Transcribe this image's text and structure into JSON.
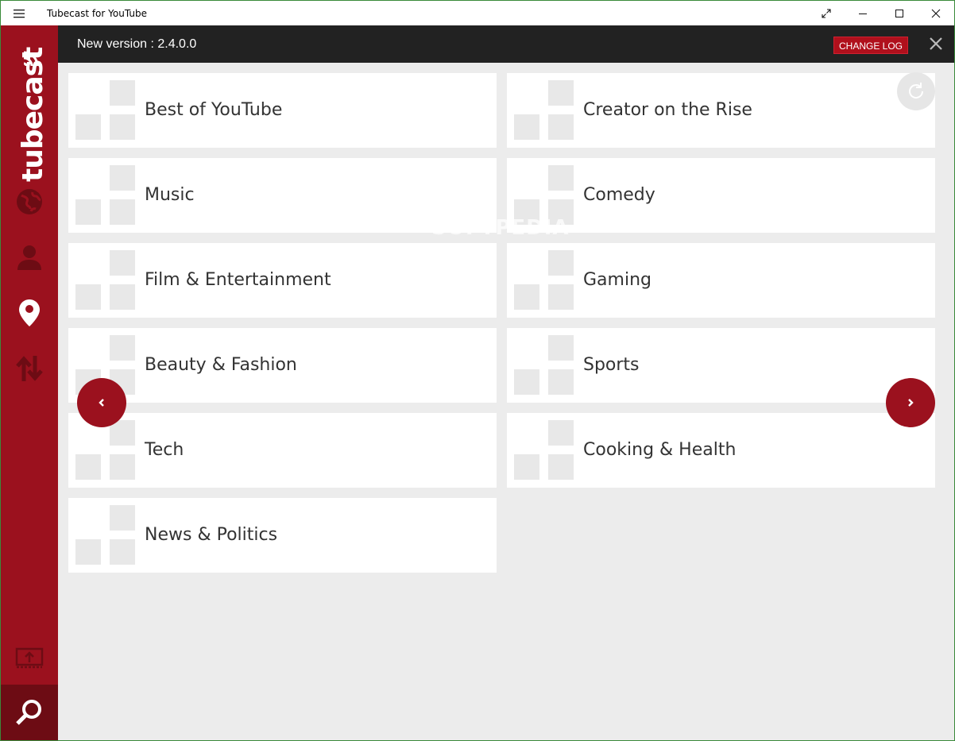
{
  "window": {
    "title": "Tubecast for YouTube"
  },
  "sidebar": {
    "logo": "tubecast",
    "items": [
      {
        "icon": "globe-icon"
      },
      {
        "icon": "user-icon"
      },
      {
        "icon": "location-pin-icon"
      },
      {
        "icon": "sort-arrows-icon"
      },
      {
        "icon": "cast-screen-icon"
      },
      {
        "icon": "search-icon"
      }
    ]
  },
  "banner": {
    "version_text": "New version : 2.4.0.0",
    "changelog_label": "CHANGE LOG"
  },
  "categories": [
    "Best of YouTube",
    "Creator on the Rise",
    "Music",
    "Comedy",
    "Film & Entertainment",
    "Gaming",
    "Beauty & Fashion",
    "Sports",
    "Tech",
    "Cooking & Health",
    "News & Politics"
  ],
  "watermark": "SOFTPEDIA",
  "colors": {
    "accent": "#9b111e",
    "accent_dark": "#6d0c14",
    "banner_bg": "#222222",
    "content_bg": "#ececec"
  }
}
